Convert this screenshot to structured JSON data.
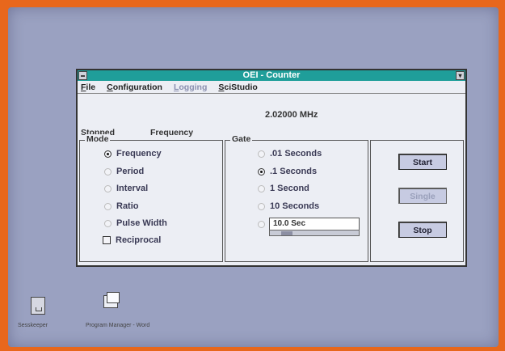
{
  "window": {
    "title": "OEI - Counter"
  },
  "menu": {
    "items": [
      "File",
      "Configuration",
      "Logging",
      "SciStudio"
    ]
  },
  "display": {
    "readout": "2.02000 MHz",
    "state": "Stopped",
    "function": "Frequency"
  },
  "mode": {
    "label": "Mode",
    "options": [
      "Frequency",
      "Period",
      "Interval",
      "Ratio",
      "Pulse Width"
    ],
    "selected": "Frequency",
    "reciprocal_label": "Reciprocal",
    "reciprocal_checked": false
  },
  "gate": {
    "label": "Gate",
    "options": [
      ".01 Seconds",
      ".1 Seconds",
      "1 Second",
      "10 Seconds"
    ],
    "selected": ".1 Seconds",
    "custom_value": "10.0 Sec"
  },
  "buttons": {
    "start": "Start",
    "single": "Single",
    "stop": "Stop"
  },
  "desktop": {
    "icons": [
      "Sesskeeper",
      "Program Manager - Word"
    ]
  },
  "colors": {
    "titlebar": "#1f9e9a",
    "desktop": "#9aa1c1",
    "frame": "#e8671c"
  }
}
